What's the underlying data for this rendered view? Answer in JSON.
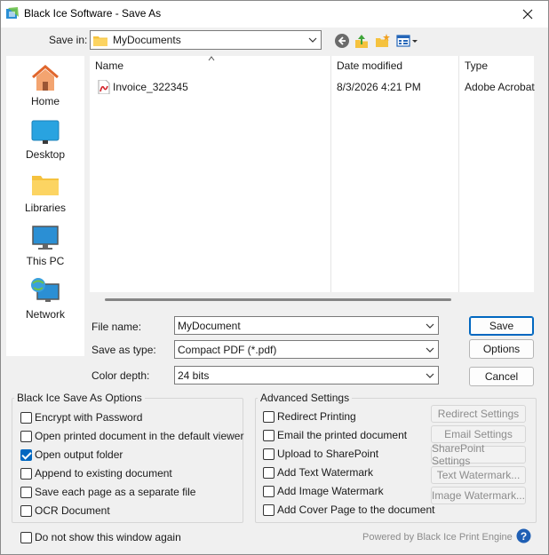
{
  "window": {
    "title": "Black Ice Software - Save As"
  },
  "toolbar": {
    "save_in_label": "Save in:",
    "save_in_value": "MyDocuments",
    "icons": [
      "back-icon",
      "up-folder-icon",
      "new-folder-icon",
      "view-menu-icon"
    ]
  },
  "places": [
    {
      "label": "Home",
      "icon": "home-icon"
    },
    {
      "label": "Desktop",
      "icon": "desktop-icon"
    },
    {
      "label": "Libraries",
      "icon": "libraries-icon"
    },
    {
      "label": "This PC",
      "icon": "this-pc-icon"
    },
    {
      "label": "Network",
      "icon": "network-icon"
    }
  ],
  "filelist": {
    "columns": [
      "Name",
      "Date modified",
      "Type"
    ],
    "rows": [
      {
        "name": "Invoice_322345",
        "date": "8/3/2026 4:21 PM",
        "type": "Adobe Acrobat",
        "icon": "pdf-file-icon"
      }
    ]
  },
  "form": {
    "file_name_label": "File name:",
    "file_name_value": "MyDocument",
    "save_as_type_label": "Save as type:",
    "save_as_type_value": "Compact PDF (*.pdf)",
    "color_depth_label": "Color depth:",
    "color_depth_value": "24 bits",
    "save_label": "Save",
    "options_label": "Options",
    "cancel_label": "Cancel"
  },
  "save_options": {
    "title": "Black Ice Save As Options",
    "items": [
      {
        "label": "Encrypt with Password",
        "checked": false
      },
      {
        "label": "Open printed document in the default viewer",
        "checked": false
      },
      {
        "label": "Open output folder",
        "checked": true
      },
      {
        "label": "Append to existing document",
        "checked": false
      },
      {
        "label": "Save each page as a separate file",
        "checked": false
      },
      {
        "label": "OCR Document",
        "checked": false
      }
    ]
  },
  "advanced": {
    "title": "Advanced Settings",
    "items": [
      {
        "label": "Redirect Printing",
        "checked": false,
        "button": "Redirect Settings"
      },
      {
        "label": "Email the printed document",
        "checked": false,
        "button": "Email Settings"
      },
      {
        "label": "Upload to SharePoint",
        "checked": false,
        "button": "SharePoint Settings"
      },
      {
        "label": "Add Text Watermark",
        "checked": false,
        "button": "Text Watermark..."
      },
      {
        "label": "Add Image Watermark",
        "checked": false,
        "button": "Image Watermark..."
      },
      {
        "label": "Add Cover Page to the document",
        "checked": false,
        "button": ""
      }
    ]
  },
  "footer": {
    "do_not_show_label": "Do not show this window again",
    "do_not_show_checked": false,
    "powered_by": "Powered by Black Ice Print Engine"
  },
  "colors": {
    "accent": "#0067c0",
    "folder": "#f5c23e",
    "pdf_red": "#d2232a"
  }
}
